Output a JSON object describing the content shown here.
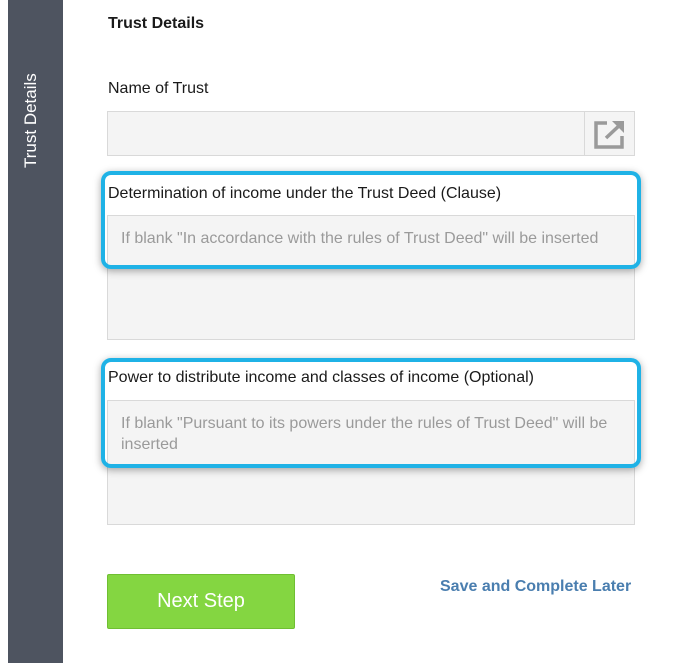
{
  "sidebar": {
    "label": "Trust Details"
  },
  "section": {
    "title": "Trust Details"
  },
  "fields": {
    "name_of_trust": {
      "label": "Name of Trust",
      "value": ""
    },
    "determination_of_income": {
      "label": "Determination of income under the Trust Deed (Clause)",
      "placeholder": "If blank \"In accordance with the rules of Trust Deed\" will be inserted"
    },
    "power_to_distribute": {
      "label": "Power to distribute income and classes of income (Optional)",
      "placeholder": "If blank \"Pursuant to its powers under the rules of Trust Deed\" will be inserted"
    }
  },
  "actions": {
    "next_label": "Next Step",
    "save_later_label": "Save and Complete Later"
  },
  "icons": {
    "expand": "open-external-icon"
  },
  "colors": {
    "sidebar_bg": "#4e5460",
    "highlight": "#1fb2e6",
    "next_button": "#84d641",
    "save_link": "#4a7eaf"
  }
}
